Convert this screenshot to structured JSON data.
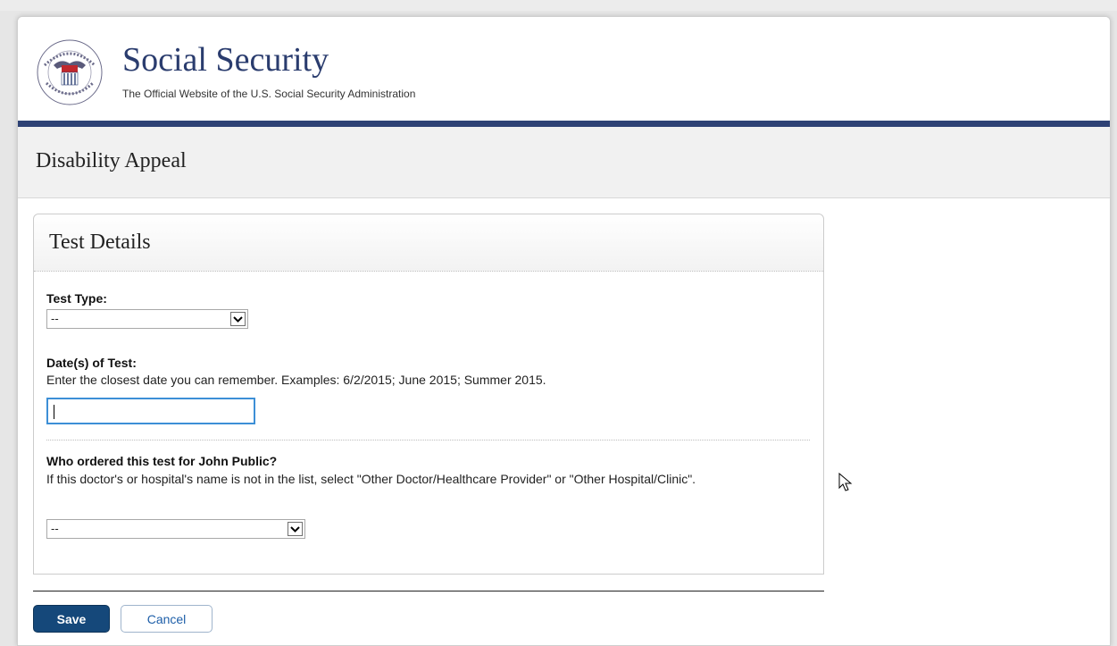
{
  "header": {
    "title": "Social Security",
    "subtitle": "The Official Website of the U.S. Social Security Administration"
  },
  "page": {
    "title": "Disability Appeal"
  },
  "panel": {
    "title": "Test Details",
    "test_type": {
      "label": "Test Type:",
      "value": "--"
    },
    "test_date": {
      "label": "Date(s) of Test:",
      "help": "Enter the closest date you can remember. Examples: 6/2/2015; June 2015; Summer 2015.",
      "value": ""
    },
    "ordered_by": {
      "label": "Who ordered this test for John Public?",
      "help": "If this doctor's or hospital's name is not in the list, select \"Other Doctor/Healthcare Provider\" or \"Other Hospital/Clinic\".",
      "value": "--"
    }
  },
  "actions": {
    "save_label": "Save",
    "cancel_label": "Cancel"
  },
  "colors": {
    "brand_navy": "#2e4275",
    "save_button": "#15487a",
    "link_blue": "#1d5ea8",
    "focus_border": "#3d8fd6"
  }
}
